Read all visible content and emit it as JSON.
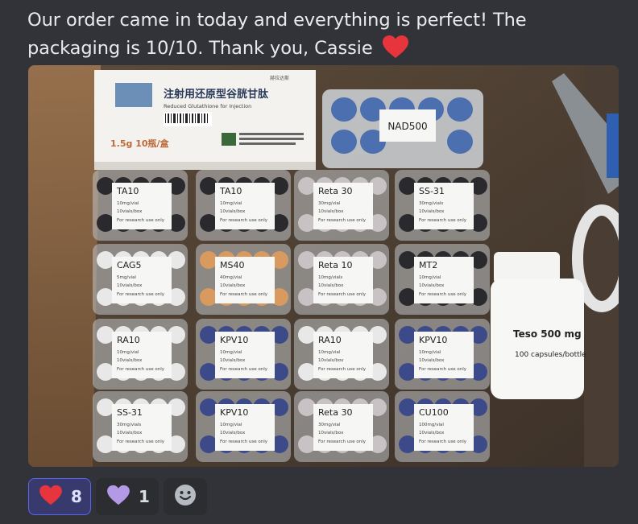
{
  "message": {
    "text": "Our order came in today and everything is perfect! The packaging is 10/10. Thank you, Cassie",
    "emoji": "red-heart"
  },
  "photo": {
    "top_box": {
      "title_cn": "注射用还原型谷胱甘肽",
      "subtitle_en": "Reduced Glutathione for Injection",
      "spec": "1.5g   10瓶/盒",
      "brand": "赫拉达斯"
    },
    "nad": "NAD500",
    "bottle": {
      "line1": "Teso  500 mg",
      "line2": "100 capsules/bottle"
    },
    "labels": [
      {
        "name": "TA10",
        "l1": "10mg/vial",
        "l2": "10vials/box",
        "l3": "For research use only"
      },
      {
        "name": "TA10",
        "l1": "10mg/vial",
        "l2": "10vials/box",
        "l3": "For research use only"
      },
      {
        "name": "Reta 30",
        "l1": "30mg/vial",
        "l2": "10vials/box",
        "l3": "For research use only"
      },
      {
        "name": "SS-31",
        "l1": "30mg/vials",
        "l2": "10vials/box",
        "l3": "For research use only"
      },
      {
        "name": "CAG5",
        "l1": "5mg/vial",
        "l2": "10vials/box",
        "l3": "For research use only"
      },
      {
        "name": "MS40",
        "l1": "40mg/vial",
        "l2": "10vials/box",
        "l3": "For research use only"
      },
      {
        "name": "Reta 10",
        "l1": "10mg/vials",
        "l2": "10vials/box",
        "l3": "For research use only"
      },
      {
        "name": "MT2",
        "l1": "10mg/vial",
        "l2": "10vials/box",
        "l3": "For research use only"
      },
      {
        "name": "RA10",
        "l1": "10mg/vial",
        "l2": "10vials/box",
        "l3": "For research use only"
      },
      {
        "name": "KPV10",
        "l1": "10mg/vial",
        "l2": "10vials/box",
        "l3": "For research use only"
      },
      {
        "name": "RA10",
        "l1": "10mg/vial",
        "l2": "10vials/box",
        "l3": "For research use only"
      },
      {
        "name": "KPV10",
        "l1": "10mg/vial",
        "l2": "10vials/box",
        "l3": "For research use only"
      },
      {
        "name": "SS-31",
        "l1": "30mg/vials",
        "l2": "10vials/box",
        "l3": "For research use only"
      },
      {
        "name": "KPV10",
        "l1": "10mg/vial",
        "l2": "10vials/box",
        "l3": "For research use only"
      },
      {
        "name": "Reta 30",
        "l1": "30mg/vial",
        "l2": "10vials/box",
        "l3": "For research use only"
      },
      {
        "name": "CU100",
        "l1": "100mg/vial",
        "l2": "10vials/box",
        "l3": "For research use only"
      }
    ]
  },
  "reactions": [
    {
      "emoji": "red-heart",
      "count": "8",
      "me": true
    },
    {
      "emoji": "purple-heart",
      "count": "1",
      "me": false
    }
  ],
  "add_reaction_icon": "smiley-icon",
  "colors": {
    "red_heart": "#e8343d",
    "purple_heart": "#b49ae6",
    "blurple": "#5865f2"
  }
}
